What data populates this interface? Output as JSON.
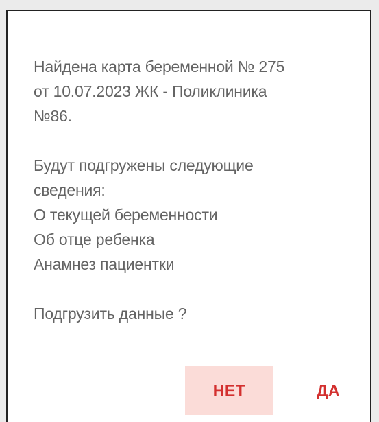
{
  "dialog": {
    "message_lines": [
      "Найдена карта беременной № 275",
      "от 10.07.2023 ЖК - Поликлиника",
      "№86.",
      "",
      "Будут подгружены следующие",
      "сведения:",
      "О текущей беременности",
      "Об отце ребенка",
      "Анамнез пациентки",
      "",
      "Подгрузить данные ?"
    ],
    "no_label": "НЕТ",
    "yes_label": "ДА"
  },
  "colors": {
    "accent": "#d3302f",
    "no_button_bg": "#fbdcd8",
    "text": "#646464"
  }
}
